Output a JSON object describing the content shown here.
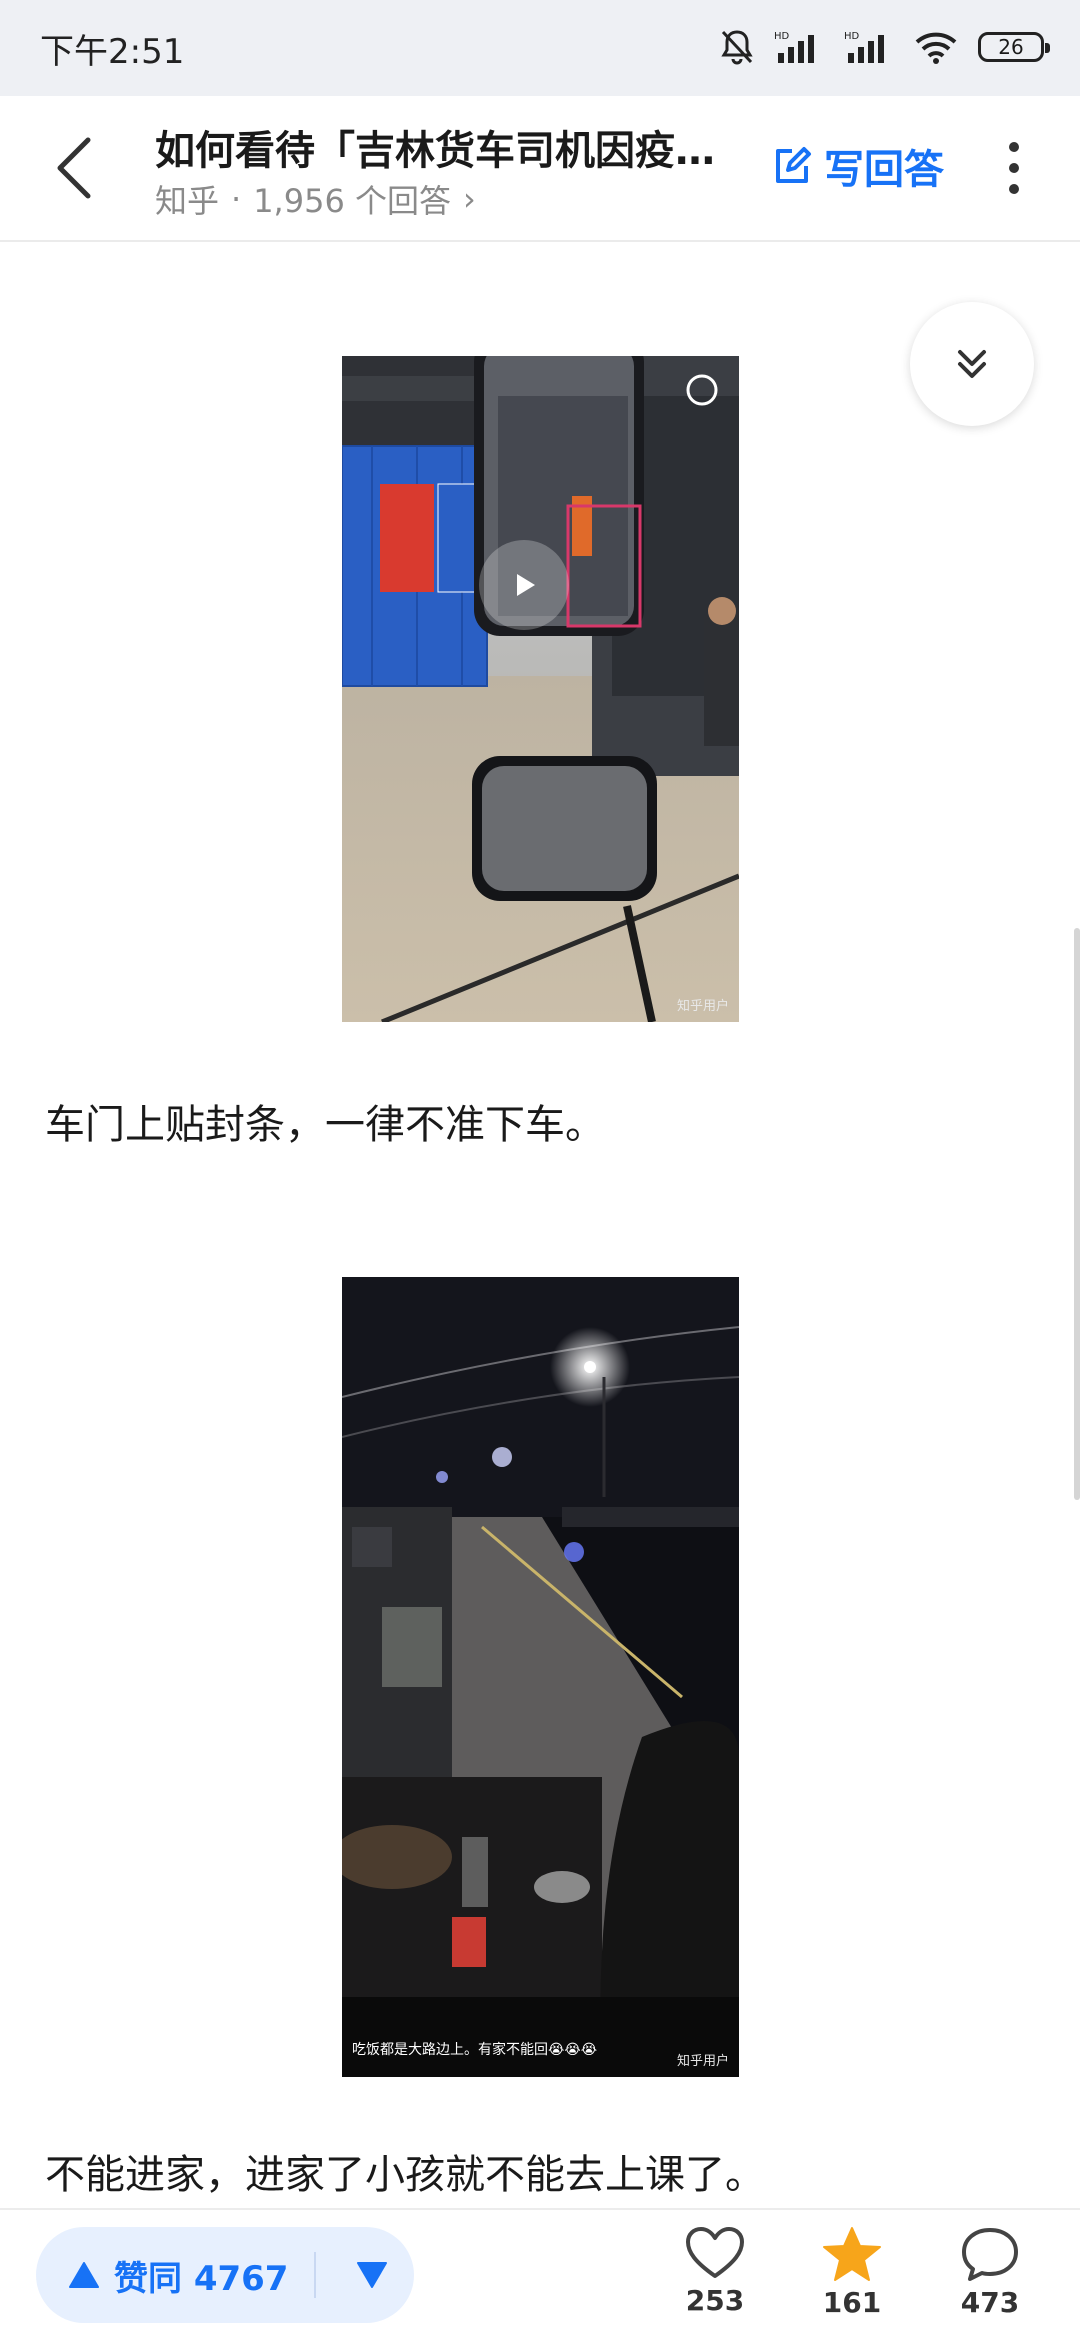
{
  "status_bar": {
    "time": "下午2:51",
    "battery": "26",
    "signal_label": "HD"
  },
  "header": {
    "question_title": "如何看待「吉林货车司机因疫…",
    "source": "知乎",
    "separator": "·",
    "answer_count": "1,956 个回答",
    "meta_chevron": "›",
    "write_answer": "写回答"
  },
  "content": {
    "video1_watermark": "知乎用户",
    "paragraph1": "车门上贴封条，一律不准下车。",
    "video2_caption": "吃饭都是大路边上。有家不能回😭😭😭",
    "video2_watermark": "知乎用户",
    "paragraph2": "不能进家，进家了小孩就不能去上课了。"
  },
  "bottom_bar": {
    "upvote_label": "赞同 4767",
    "likes": "253",
    "favorites": "161",
    "comments": "473"
  },
  "colors": {
    "accent": "#1772f6",
    "star": "#f7a51a"
  }
}
